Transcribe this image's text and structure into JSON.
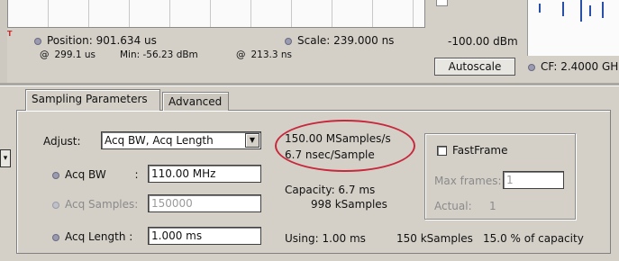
{
  "top": {
    "position_label": "Position: 901.634 us",
    "scale_label": "Scale: 239.000 ns",
    "left_time": "299.1 us",
    "min_label": "Min: -56.23 dBm",
    "right_time": "213.3 ns",
    "trigger_mark": "T"
  },
  "spectrum": {
    "ref_level": "-100.00 dBm",
    "autoscale_label": "Autoscale",
    "cf_label": "CF: 2.4000 GH"
  },
  "tabs": {
    "sampling": "Sampling Parameters",
    "advanced": "Advanced"
  },
  "form": {
    "adjust_label": "Adjust:",
    "adjust_value": "Acq BW, Acq Length",
    "acq_bw_label": "Acq BW",
    "acq_bw_value": "110.00 MHz",
    "acq_samples_label": "Acq Samples:",
    "acq_samples_value": "150000",
    "acq_length_label": "Acq Length :",
    "acq_length_value": "1.000 ms"
  },
  "rate": {
    "samples_rate": "150.00 MSamples/s",
    "sample_period": "6.7 nsec/Sample"
  },
  "capacity": {
    "capacity_label": "Capacity: 6.7 ms",
    "capacity_samples": "998 kSamples",
    "using_label": "Using: 1.00 ms",
    "using_samples": "150 kSamples",
    "using_percent": "15.0 % of capacity"
  },
  "fastframe": {
    "label": "FastFrame",
    "max_frames_label": "Max frames:",
    "max_frames_value": "1",
    "actual_label": "Actual:",
    "actual_value": "1"
  },
  "colors": {
    "highlight_ellipse": "#c8283c",
    "spectrum_trace": "#2850a8"
  }
}
